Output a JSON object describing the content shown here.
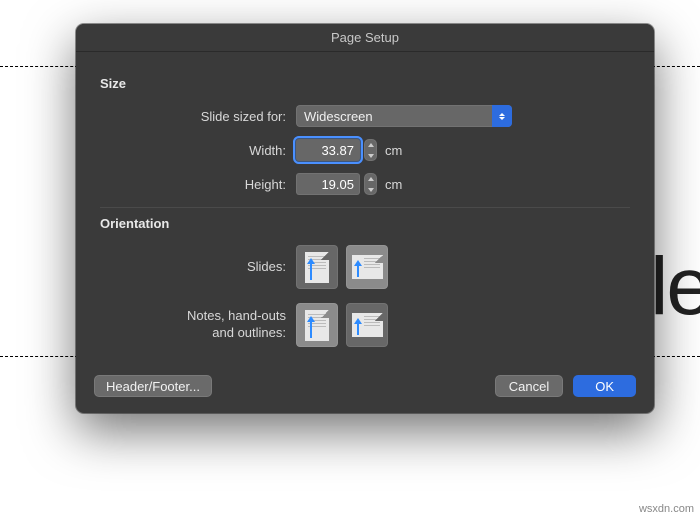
{
  "dialog": {
    "title": "Page Setup",
    "size": {
      "section_label": "Size",
      "sized_for_label": "Slide sized for:",
      "sized_for_value": "Widescreen",
      "width_label": "Width:",
      "width_value": "33.87",
      "width_unit": "cm",
      "height_label": "Height:",
      "height_value": "19.05",
      "height_unit": "cm"
    },
    "orientation": {
      "section_label": "Orientation",
      "slides_label": "Slides:",
      "slides_selected": "landscape",
      "notes_label": "Notes, hand-outs\nand outlines:",
      "notes_selected": "portrait"
    },
    "buttons": {
      "header_footer": "Header/Footer...",
      "cancel": "Cancel",
      "ok": "OK"
    }
  },
  "background": {
    "partial_text": "tle"
  },
  "watermark": "wsxdn.com"
}
